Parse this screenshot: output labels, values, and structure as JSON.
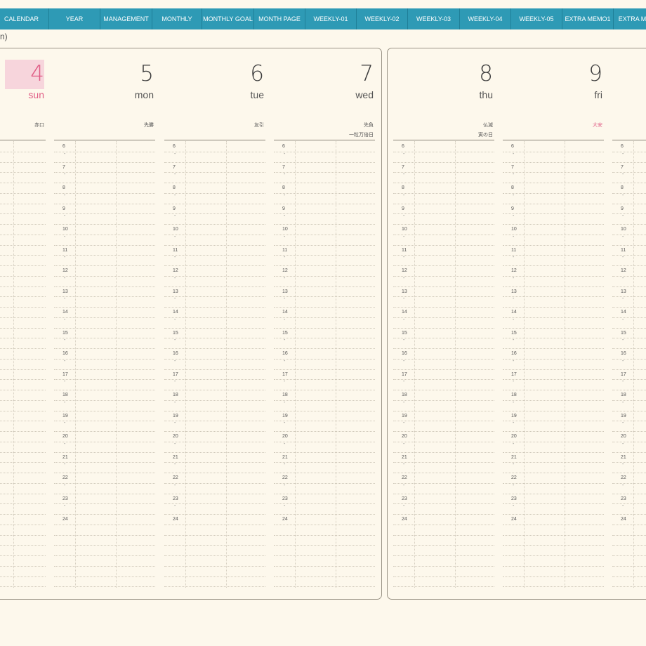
{
  "nav": {
    "tabs": [
      "CALENDAR",
      "YEAR",
      "MANAGEMENT",
      "MONTHLY",
      "MONTHLY GOAL",
      "MONTH PAGE",
      "WEEKLY-01",
      "WEEKLY-02",
      "WEEKLY-03",
      "WEEKLY-04",
      "WEEKLY-05",
      "EXTRA MEMO1",
      "EXTRA ME"
    ]
  },
  "header": {
    "corner_text": "n)"
  },
  "colors": {
    "tab_bg": "#2e9ab5",
    "paper": "#fdf8ec",
    "sunday": "#e05c85",
    "sunday_highlight": "#f7d5dc",
    "taian": "#e05c85"
  },
  "days": [
    {
      "num": "4",
      "name": "sun",
      "note1": "赤口",
      "note2": ""
    },
    {
      "num": "5",
      "name": "mon",
      "note1": "先勝",
      "note2": ""
    },
    {
      "num": "6",
      "name": "tue",
      "note1": "友引",
      "note2": ""
    },
    {
      "num": "7",
      "name": "wed",
      "note1": "先負",
      "note2": "一粒万倍日"
    },
    {
      "num": "8",
      "name": "thu",
      "note1": "仏滅",
      "note2": "寅の日"
    },
    {
      "num": "9",
      "name": "fri",
      "note1": "大安",
      "note2": ""
    },
    {
      "num": "",
      "name": "",
      "note1": "",
      "note2": ""
    }
  ],
  "hours": [
    "6",
    "7",
    "8",
    "9",
    "10",
    "11",
    "12",
    "13",
    "14",
    "15",
    "16",
    "17",
    "18",
    "19",
    "20",
    "21",
    "22",
    "23",
    "24"
  ],
  "half_mark": "-"
}
